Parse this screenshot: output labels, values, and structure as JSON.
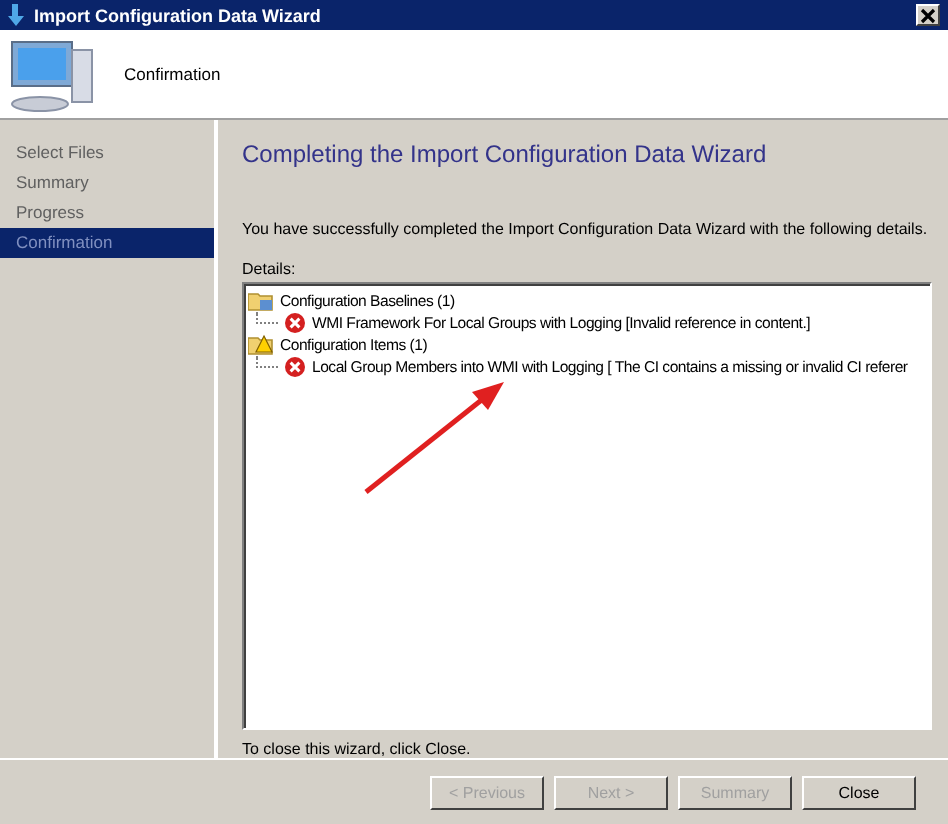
{
  "window": {
    "title": "Import Configuration Data Wizard"
  },
  "header": {
    "title": "Confirmation"
  },
  "steps": [
    {
      "label": "Select Files",
      "selected": false
    },
    {
      "label": "Summary",
      "selected": false
    },
    {
      "label": "Progress",
      "selected": false
    },
    {
      "label": "Confirmation",
      "selected": true
    }
  ],
  "page_title": "Completing the Import Configuration Data Wizard",
  "message": "You have successfully completed the Import Configuration Data Wizard with the following details.",
  "details_label": "Details:",
  "tree": [
    {
      "label": "Configuration Baselines (1)",
      "kind": "folder",
      "children": [
        {
          "label": "WMI Framework For Local Groups with Logging [Invalid reference in content.]",
          "kind": "error"
        }
      ]
    },
    {
      "label": "Configuration Items (1)",
      "kind": "folder-warning",
      "children": [
        {
          "label": "Local Group Members into WMI with Logging [ The CI contains a missing or invalid CI referer",
          "kind": "error"
        }
      ]
    }
  ],
  "close_hint": "To close this wizard, click Close.",
  "buttons": [
    {
      "label": "< Previous",
      "disabled": true
    },
    {
      "label": "Next >",
      "disabled": true
    },
    {
      "label": "Summary",
      "disabled": true
    },
    {
      "label": "Close",
      "disabled": false
    }
  ]
}
